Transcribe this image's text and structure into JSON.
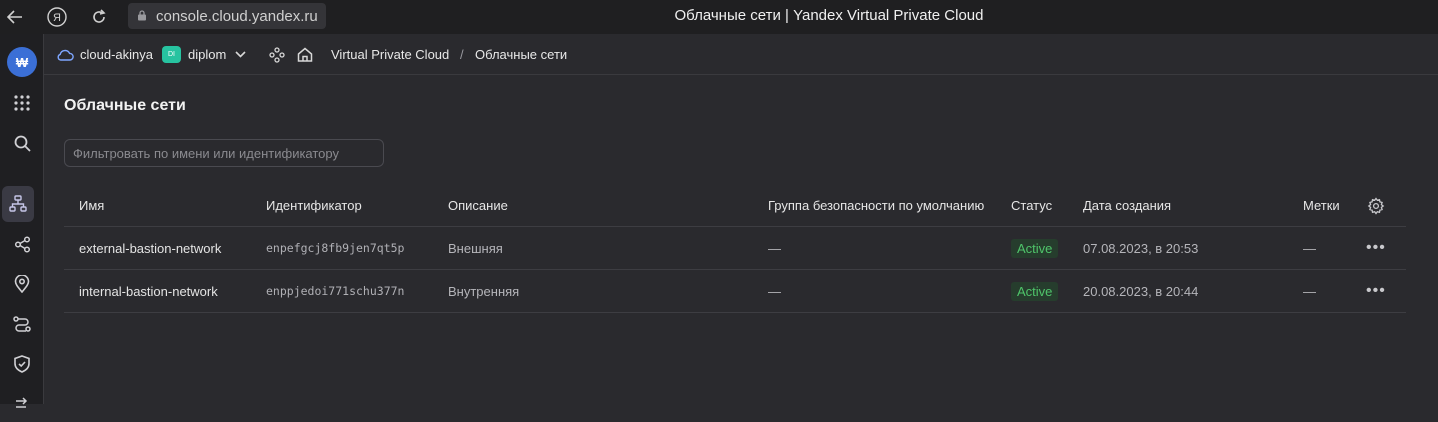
{
  "browser": {
    "url": "console.cloud.yandex.ru",
    "window_title": "Облачные сети | Yandex Virtual Private Cloud",
    "back_icon": "arrow-left-icon",
    "reload_icon": "reload-icon",
    "yandex_icon": "Я"
  },
  "topbar": {
    "cloud": "cloud-akinya",
    "folder_badge": "DI",
    "folder": "diplom",
    "breadcrumb_service": "Virtual Private Cloud",
    "breadcrumb_sep": "/",
    "breadcrumb_current": "Облачные сети"
  },
  "sidebar": {
    "logo": "₩",
    "items": [
      "grid-icon",
      "search-icon",
      "network-icon",
      "share-icon",
      "location-icon",
      "route-icon",
      "shield-icon"
    ]
  },
  "main": {
    "title": "Облачные сети",
    "filter_placeholder": "Фильтровать по имени или идентификатору",
    "columns": [
      "Имя",
      "Идентификатор",
      "Описание",
      "Группа безопасности по умолчанию",
      "Статус",
      "Дата создания",
      "Метки"
    ],
    "rows": [
      {
        "name": "external-bastion-network",
        "id": "enpefgcj8fb9jen7qt5p",
        "description": "Внешняя",
        "security_group": "—",
        "status": "Active",
        "created": "07.08.2023, в 20:53",
        "labels": "—"
      },
      {
        "name": "internal-bastion-network",
        "id": "enppjedoi771schu377n",
        "description": "Внутренняя",
        "security_group": "—",
        "status": "Active",
        "created": "20.08.2023, в 20:44",
        "labels": "—"
      }
    ],
    "actions_label": "•••"
  },
  "colors": {
    "background": "#2a2a2e",
    "sidebar": "#1f1f22",
    "accent": "#3b6fd6",
    "status_active": "#4fc46a",
    "folder_badge": "#27c3a0"
  }
}
